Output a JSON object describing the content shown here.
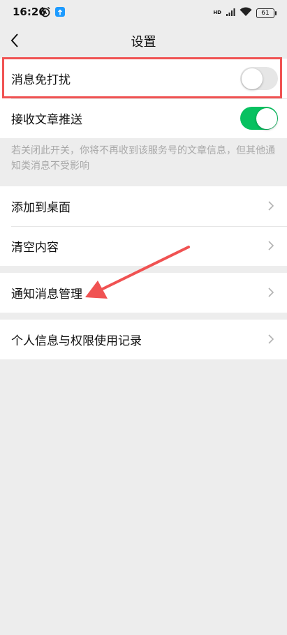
{
  "status_bar": {
    "time": "16:26",
    "alarm_icon": "alarm-clock-icon",
    "app_icon": "upload-notification-icon",
    "hd_label": "HD",
    "signal_icon": "cell-signal-icon",
    "wifi_icon": "wifi-icon",
    "battery": "61"
  },
  "header": {
    "title": "设置",
    "back_icon": "chevron-left-icon"
  },
  "toggles": [
    {
      "label": "消息免打扰",
      "state": "off"
    },
    {
      "label": "接收文章推送",
      "state": "on"
    }
  ],
  "hint_text": "若关闭此开关，你将不再收到该服务号的文章信息，但其他通知类消息不受影响",
  "menu_group1": [
    {
      "label": "添加到桌面"
    },
    {
      "label": "清空内容"
    }
  ],
  "menu_group2": [
    {
      "label": "通知消息管理"
    }
  ],
  "menu_group3": [
    {
      "label": "个人信息与权限使用记录"
    }
  ],
  "colors": {
    "background": "#ededed",
    "toggle_on": "#07c160",
    "toggle_off": "#e6e6e6",
    "annotation": "#f05252"
  }
}
